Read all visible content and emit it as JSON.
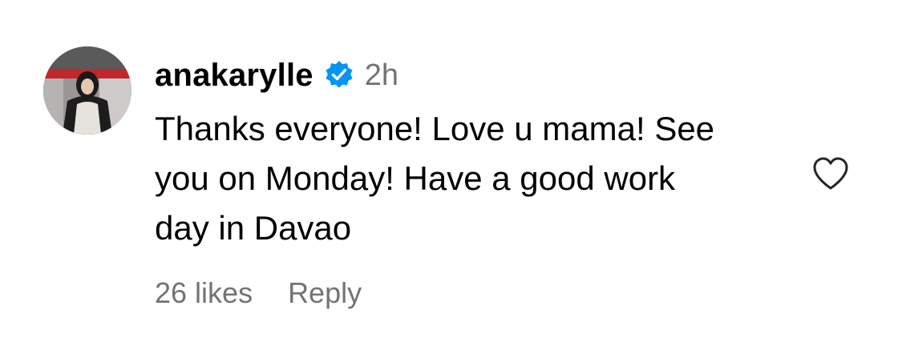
{
  "comment": {
    "username": "anakarylle",
    "verified": true,
    "time": "2h",
    "text_lines": [
      "Thanks everyone! Love u mama! See",
      "you on Monday! Have a good work",
      "day in Davao"
    ],
    "likes": "26 likes",
    "reply_label": "Reply"
  },
  "icons": {
    "verified": "verified-badge-icon",
    "like": "heart-outline-icon"
  },
  "colors": {
    "verified_badge": "#0095F6",
    "secondary_text": "#737373",
    "primary_text": "#000000"
  }
}
